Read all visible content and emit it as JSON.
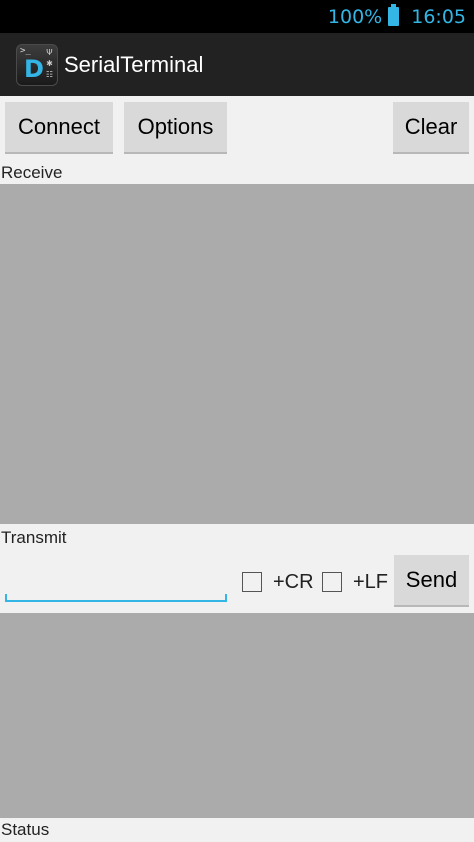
{
  "status_bar": {
    "battery_percent": "100%",
    "time": "16:05"
  },
  "action_bar": {
    "app_title": "SerialTerminal",
    "icon_name": "serialterminal-app-icon"
  },
  "toolbar": {
    "connect_label": "Connect",
    "options_label": "Options",
    "clear_label": "Clear"
  },
  "receive": {
    "label": "Receive"
  },
  "transmit": {
    "label": "Transmit",
    "input_value": "",
    "cr_label": "+CR",
    "lf_label": "+LF",
    "cr_checked": false,
    "lf_checked": false,
    "send_label": "Send"
  },
  "status": {
    "label": "Status"
  },
  "colors": {
    "accent": "#33b5e5",
    "panel_gray": "#ababab",
    "action_bar": "#222222",
    "background": "#f1f1f1"
  }
}
